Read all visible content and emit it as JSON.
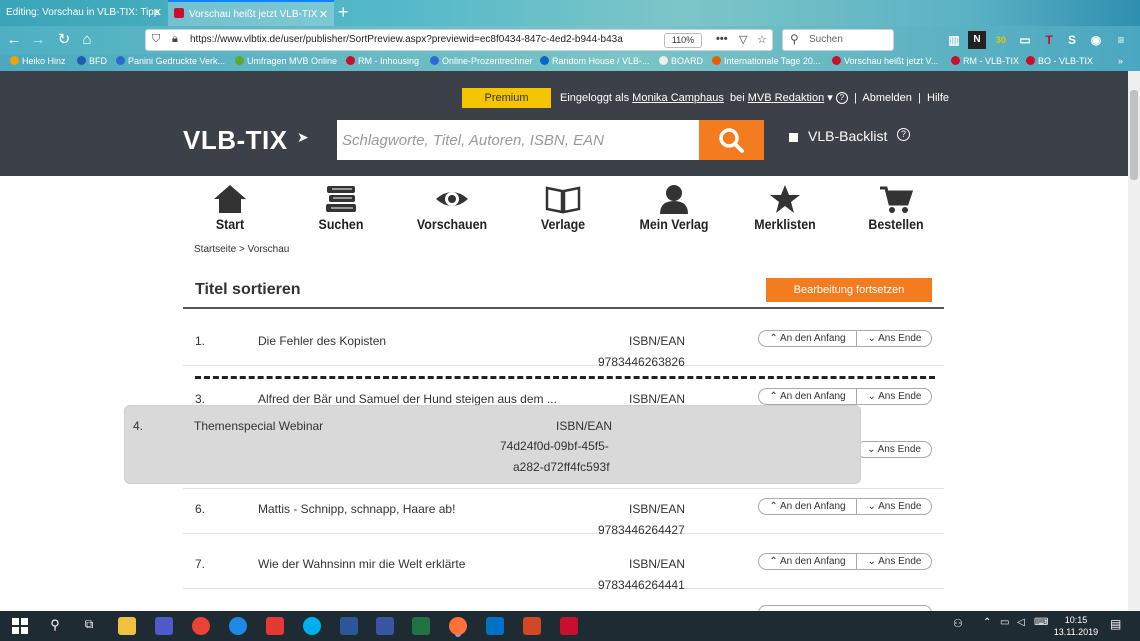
{
  "browser": {
    "tabs": [
      {
        "title": "Editing: Vorschau in VLB-TIX: Tipp"
      },
      {
        "title": "Vorschau heißt jetzt VLB-TIX"
      }
    ],
    "url": "https://www.vlbtix.de/user/publisher/SortPreview.aspx?previewid=ec8f0434-847c-4ed2-b944-b43a",
    "zoom": "110%",
    "search_placeholder": "Suchen",
    "bookmarks": [
      "Heiko Hinz",
      "BFD",
      "Panini Gedruckte Verk...",
      "Umfragen MVB Online",
      "RM - Inhousing",
      "Online-Prozentrechner",
      "Random House / VLB-...",
      "BOARD",
      "Internationale Tage 20...",
      "Vorschau heißt jetzt V...",
      "RM - VLB-TIX",
      "BO - VLB-TIX"
    ]
  },
  "header": {
    "premium": "Premium",
    "login_prefix": "Eingeloggt als",
    "user": "Monika Camphaus",
    "at": "bei",
    "org": "MVB Redaktion",
    "logout": "Abmelden",
    "help": "Hilfe",
    "logo": "VLB-TIX",
    "search_placeholder": "Schlagworte, Titel, Autoren, ISBN, EAN",
    "backlist": "VLB-Backlist"
  },
  "nav": [
    "Start",
    "Suchen",
    "Vorschauen",
    "Verlage",
    "Mein Verlag",
    "Merklisten",
    "Bestellen"
  ],
  "breadcrumb": "Startseite > Vorschau",
  "page": {
    "title": "Titel sortieren",
    "continue_button": "Bearbeitung fortsetzen",
    "isbn_label": "ISBN/EAN",
    "to_start": "An den Anfang",
    "to_end": "Ans Ende"
  },
  "rows": [
    {
      "num": "1.",
      "title": "Die Fehler des Kopisten",
      "isbn": "9783446263826"
    },
    {
      "num": "3.",
      "title": "Alfred der Bär und Samuel der Hund steigen aus dem ...",
      "isbn": ""
    },
    {
      "num": "6.",
      "title": "Mattis - Schnipp, schnapp, Haare ab!",
      "isbn": "9783446264427"
    },
    {
      "num": "7.",
      "title": "Wie der Wahnsinn mir die Welt erklärte",
      "isbn": "9783446264441"
    }
  ],
  "dragged": {
    "num": "4.",
    "title": "Themenspecial Webinar",
    "isbn_label": "ISBN/EAN",
    "id_line1": "74d24f0d-09bf-45f5-",
    "id_line2": "a282-d72ff4fc593f"
  },
  "taskbar": {
    "time": "10:15",
    "date": "13.11.2019"
  },
  "colors": {
    "accent": "#f47c20",
    "header_bg": "#3c4049",
    "premium": "#f4c400"
  }
}
